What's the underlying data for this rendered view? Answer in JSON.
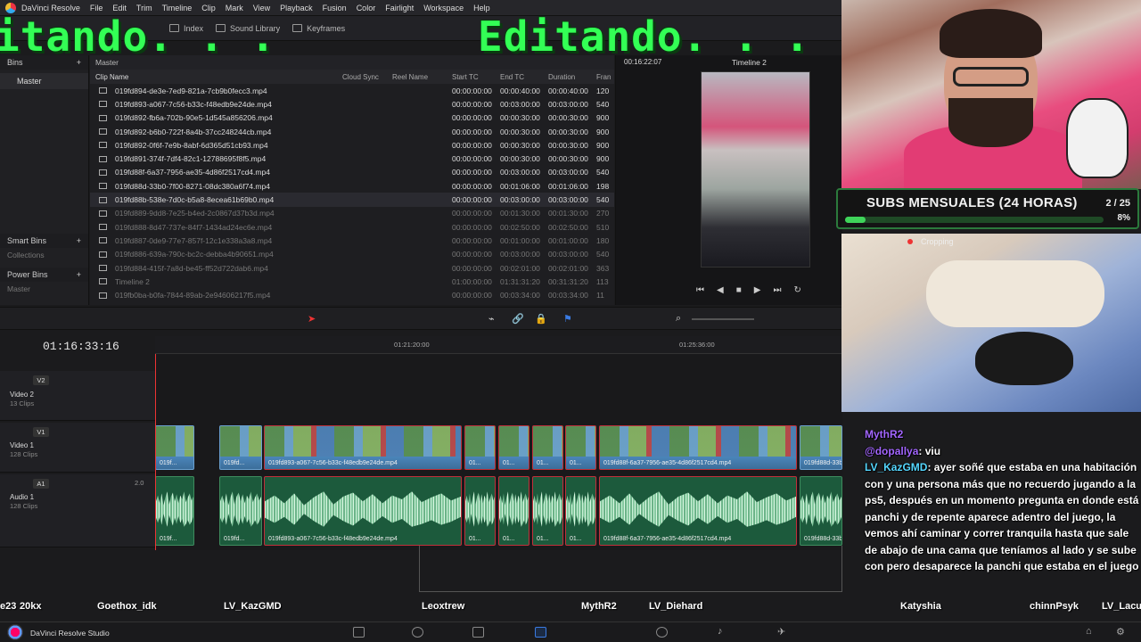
{
  "menubar": {
    "app_name": "DaVinci Resolve",
    "items": [
      "File",
      "Edit",
      "Trim",
      "Timeline",
      "Clip",
      "Mark",
      "View",
      "Playback",
      "Fusion",
      "Color",
      "Fairlight",
      "Workspace",
      "Help"
    ]
  },
  "toolbar": {
    "index_label": "Index",
    "sound_library_label": "Sound Library",
    "keyframes_label": "Keyframes"
  },
  "overlay": {
    "edit_text_left": "itando. . .",
    "edit_text_right": "Editando. . ."
  },
  "bins": {
    "header": "Bins",
    "master": "Master",
    "smart_bins": "Smart Bins",
    "collections": "Collections",
    "power_bins": "Power Bins",
    "power_master": "Master"
  },
  "pool": {
    "breadcrumb": "Master",
    "columns": [
      "Clip Name",
      "Cloud Sync",
      "Reel Name",
      "Start TC",
      "End TC",
      "Duration",
      "Fran"
    ],
    "rows": [
      {
        "name": "019fd894-de3e-7ed9-821a-7cb9b0fecc3.mp4",
        "start": "00:00:00:00",
        "end": "00:00:40:00",
        "dur": "00:00:40:00",
        "fr": "120"
      },
      {
        "name": "019fd893-a067-7c56-b33c-f48edb9e24de.mp4",
        "start": "00:00:00:00",
        "end": "00:03:00:00",
        "dur": "00:03:00:00",
        "fr": "540"
      },
      {
        "name": "019fd892-fb6a-702b-90e5-1d545a856206.mp4",
        "start": "00:00:00:00",
        "end": "00:00:30:00",
        "dur": "00:00:30:00",
        "fr": "900"
      },
      {
        "name": "019fd892-b6b0-722f-8a4b-37cc248244cb.mp4",
        "start": "00:00:00:00",
        "end": "00:00:30:00",
        "dur": "00:00:30:00",
        "fr": "900"
      },
      {
        "name": "019fd892-0f6f-7e9b-8abf-6d365d51cb93.mp4",
        "start": "00:00:00:00",
        "end": "00:00:30:00",
        "dur": "00:00:30:00",
        "fr": "900"
      },
      {
        "name": "019fd891-374f-7df4-82c1-12788695f8f5.mp4",
        "start": "00:00:00:00",
        "end": "00:00:30:00",
        "dur": "00:00:30:00",
        "fr": "900"
      },
      {
        "name": "019fd88f-6a37-7956-ae35-4d86f2517cd4.mp4",
        "start": "00:00:00:00",
        "end": "00:03:00:00",
        "dur": "00:03:00:00",
        "fr": "540"
      },
      {
        "name": "019fd88d-33b0-7f00-8271-08dc380a6f74.mp4",
        "start": "00:00:00:00",
        "end": "00:01:06:00",
        "dur": "00:01:06:00",
        "fr": "198"
      },
      {
        "name": "019fd88b-538e-7d0c-b5a8-8ecea61b69b0.mp4",
        "start": "00:00:00:00",
        "end": "00:03:00:00",
        "dur": "00:03:00:00",
        "fr": "540"
      },
      {
        "name": "019fd889-9dd8-7e25-b4ed-2c0867d37b3d.mp4",
        "start": "00:00:00:00",
        "end": "00:01:30:00",
        "dur": "00:01:30:00",
        "fr": "270"
      },
      {
        "name": "019fd888-8d47-737e-84f7-1434ad24ec6e.mp4",
        "start": "00:00:00:00",
        "end": "00:02:50:00",
        "dur": "00:02:50:00",
        "fr": "510"
      },
      {
        "name": "019fd887-0de9-77e7-857f-12c1e338a3a8.mp4",
        "start": "00:00:00:00",
        "end": "00:01:00:00",
        "dur": "00:01:00:00",
        "fr": "180"
      },
      {
        "name": "019fd886-639a-790c-bc2c-debba4b90651.mp4",
        "start": "00:00:00:00",
        "end": "00:03:00:00",
        "dur": "00:03:00:00",
        "fr": "540"
      },
      {
        "name": "019fd884-415f-7a8d-be45-ff52d722dab6.mp4",
        "start": "00:00:00:00",
        "end": "00:02:01:00",
        "dur": "00:02:01:00",
        "fr": "363"
      },
      {
        "name": "Timeline 2",
        "start": "01:00:00:00",
        "end": "01:31:31:20",
        "dur": "00:31:31:20",
        "fr": "113"
      },
      {
        "name": "019fb0ba-b0fa-7844-89ab-2e94606217f5.mp4",
        "start": "00:00:00:00",
        "end": "00:03:34:00",
        "dur": "00:03:34:00",
        "fr": "11"
      }
    ]
  },
  "viewer": {
    "timecode": "00:16:22:07",
    "timeline_name": "Timeline 2"
  },
  "timeline": {
    "timecode": "01:16:33:16",
    "ruler_labels": [
      "01:21:20:00",
      "01:25:36:00"
    ],
    "tracks": {
      "v2": {
        "id": "V2",
        "name": "Video 2",
        "clips": "13 Clips"
      },
      "v1": {
        "id": "V1",
        "name": "Video 1",
        "clips": "128 Clips"
      },
      "a1": {
        "id": "A1",
        "name": "Audio 1",
        "clips": "128 Clips",
        "level": "2.0"
      }
    },
    "video_clips": [
      "019f...",
      "019fd...",
      "019fd893-a067-7c56-b33c-f48edb9e24de.mp4",
      "01...",
      "01...",
      "01...",
      "01...",
      "019fd88f-6a37-7956-ae35-4d86f2517cd4.mp4",
      "019fd88d-33b0..."
    ],
    "audio_clips": [
      "019f...",
      "019fd...",
      "019fd893-a067-7c56-b33c-f48edb9e24de.mp4",
      "01...",
      "01...",
      "01...",
      "01...",
      "019fd88f-6a37-7956-ae35-4d86f2517cd4.mp4",
      "019fd88d-33b0..."
    ]
  },
  "stream": {
    "subs_title": "SUBS MENSUALES (24 HORAS)",
    "subs_count": "2 / 25",
    "subs_percent": "8%",
    "subs_progress": 0.08,
    "catcam_label": "Cropping",
    "chat": [
      {
        "user": "MythR2",
        "text": ""
      },
      {
        "user": "@dopallya",
        "text": ": viu"
      },
      {
        "user": "LV_KazGMD",
        "text": ": ayer soñé que estaba en una habitación con y una persona más que no recuerdo jugando a la ps5, después en un momento pregunta en donde está panchi y de repente aparece adentro del juego, la vemos ahí caminar y correr tranquila hasta que sale de abajo de una cama que teníamos al lado y se sube con pero desaparece la panchi que estaba en el juego"
      }
    ],
    "names": [
      "e23",
      "20kx",
      "Goethox_idk",
      "LV_KazGMD",
      "Leoxtrew",
      "MythR2",
      "LV_Diehard",
      "Katyshia",
      "chinnPsyk",
      "LV_Lacu"
    ]
  },
  "taskbar": {
    "app_label": "DaVinci Resolve Studio"
  },
  "colors": {
    "accent_green": "#33ff55",
    "video_clip": "#4b86bb",
    "audio_clip": "#1c5a3c",
    "subs_bar": "#3fd45a",
    "chat_user": "#55d7ff"
  }
}
